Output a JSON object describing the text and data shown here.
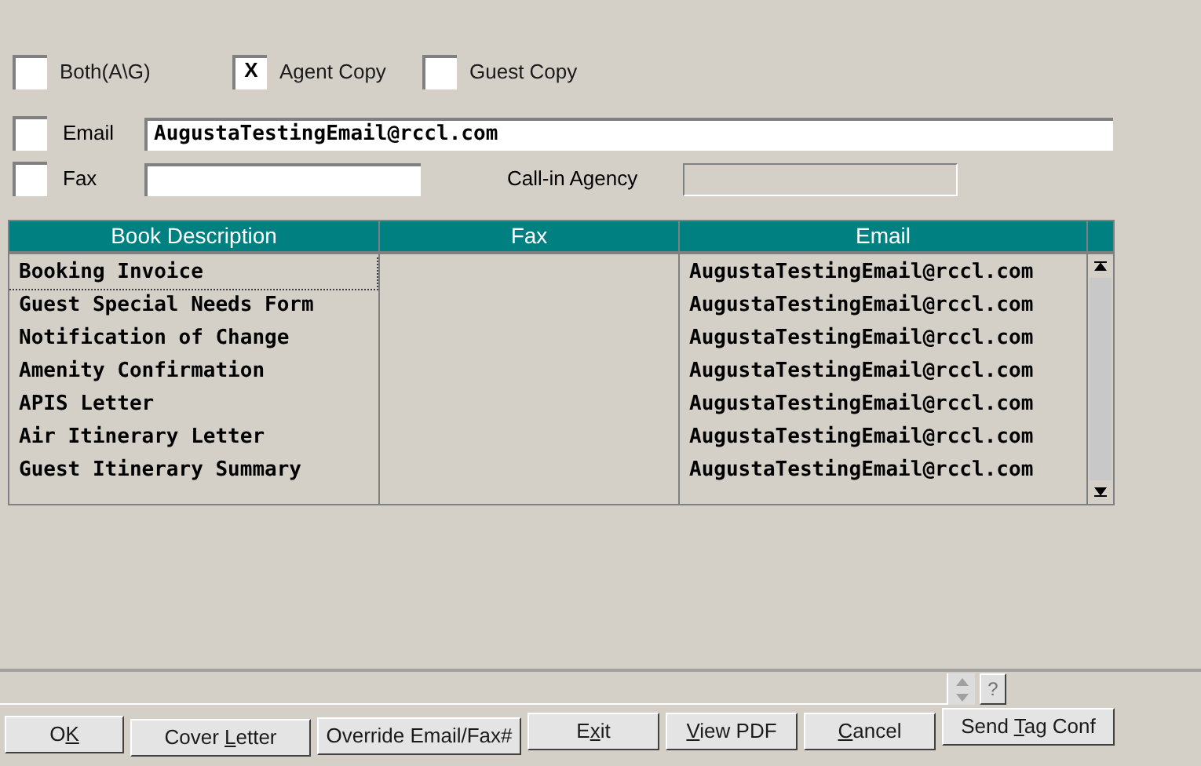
{
  "copy_options": [
    {
      "label": "Both(A\\G)",
      "checked": false
    },
    {
      "label": "Agent Copy",
      "checked": true,
      "mark": "X"
    },
    {
      "label": "Guest Copy",
      "checked": false
    }
  ],
  "email": {
    "label": "Email",
    "checked": false,
    "value": "AugustaTestingEmail@rccl.com"
  },
  "fax": {
    "label": "Fax",
    "checked": false,
    "call_in_label": "Call-in Agency"
  },
  "table": {
    "columns": [
      "Book Description",
      "Fax",
      "Email"
    ],
    "rows": [
      {
        "description": "Booking Invoice",
        "email": "AugustaTestingEmail@rccl.com",
        "selected": true
      },
      {
        "description": "Guest Special Needs Form",
        "email": "AugustaTestingEmail@rccl.com",
        "selected": false
      },
      {
        "description": "Notification of Change",
        "email": "AugustaTestingEmail@rccl.com",
        "selected": false
      },
      {
        "description": "Amenity Confirmation",
        "email": "AugustaTestingEmail@rccl.com",
        "selected": false
      },
      {
        "description": "APIS Letter",
        "email": "AugustaTestingEmail@rccl.com",
        "selected": false
      },
      {
        "description": "Air Itinerary Letter",
        "email": "AugustaTestingEmail@rccl.com",
        "selected": false
      },
      {
        "description": "Guest Itinerary Summary",
        "email": "AugustaTestingEmail@rccl.com",
        "selected": false
      }
    ]
  },
  "help_button": "?",
  "buttons": [
    {
      "parts": [
        {
          "text": "O",
          "underlined": false
        },
        {
          "text": "K",
          "underlined": true
        }
      ]
    },
    {
      "parts": [
        {
          "text": "Cover ",
          "underlined": false
        },
        {
          "text": "L",
          "underlined": true
        },
        {
          "text": "etter",
          "underlined": false
        }
      ]
    },
    {
      "parts": [
        {
          "text": "Override Email/Fax#",
          "underlined": false
        }
      ]
    },
    {
      "parts": [
        {
          "text": "E",
          "underlined": false
        },
        {
          "text": "x",
          "underlined": true
        },
        {
          "text": "it",
          "underlined": false
        }
      ]
    },
    {
      "parts": [
        {
          "text": "V",
          "underlined": true
        },
        {
          "text": "iew PDF",
          "underlined": false
        }
      ]
    },
    {
      "parts": [
        {
          "text": "C",
          "underlined": true
        },
        {
          "text": "ancel",
          "underlined": false
        }
      ]
    },
    {
      "parts": [
        {
          "text": "Send ",
          "underlined": false
        },
        {
          "text": "T",
          "underlined": true
        },
        {
          "text": "ag Conf",
          "underlined": false
        }
      ]
    }
  ]
}
